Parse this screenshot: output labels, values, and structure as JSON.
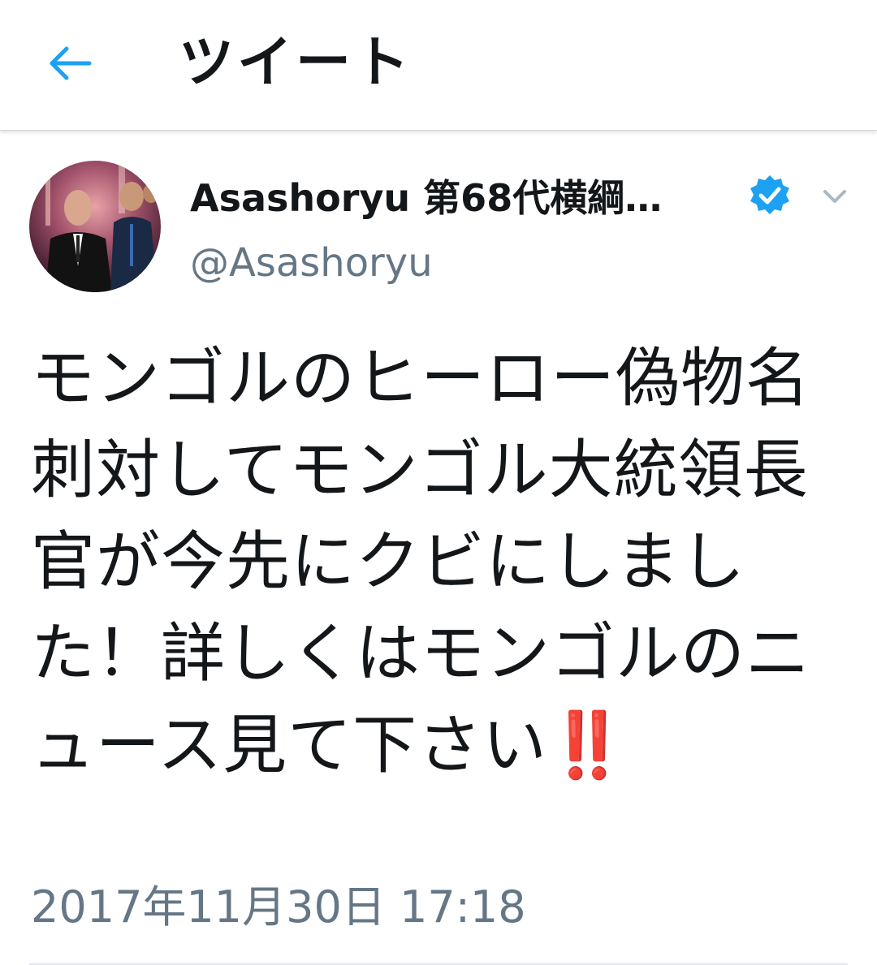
{
  "header": {
    "back_icon": "arrow-left-icon",
    "title": "ツイート",
    "accent_color": "#1da1f2"
  },
  "tweet": {
    "avatar_icon": "profile-photo",
    "display_name": "Asashoryu 第68代横綱…",
    "verified_icon": "verified-badge-icon",
    "menu_icon": "chevron-down-icon",
    "handle": "@Asashoryu",
    "text": "モンゴルのヒーロー偽物名刺対してモンゴル大統領長官が今先にクビにしました！詳しくはモンゴルのニュース見て下さい",
    "emphasis": "‼️",
    "emphasis_color": "#e4001a",
    "timestamp": "2017年11月30日 17:18"
  }
}
